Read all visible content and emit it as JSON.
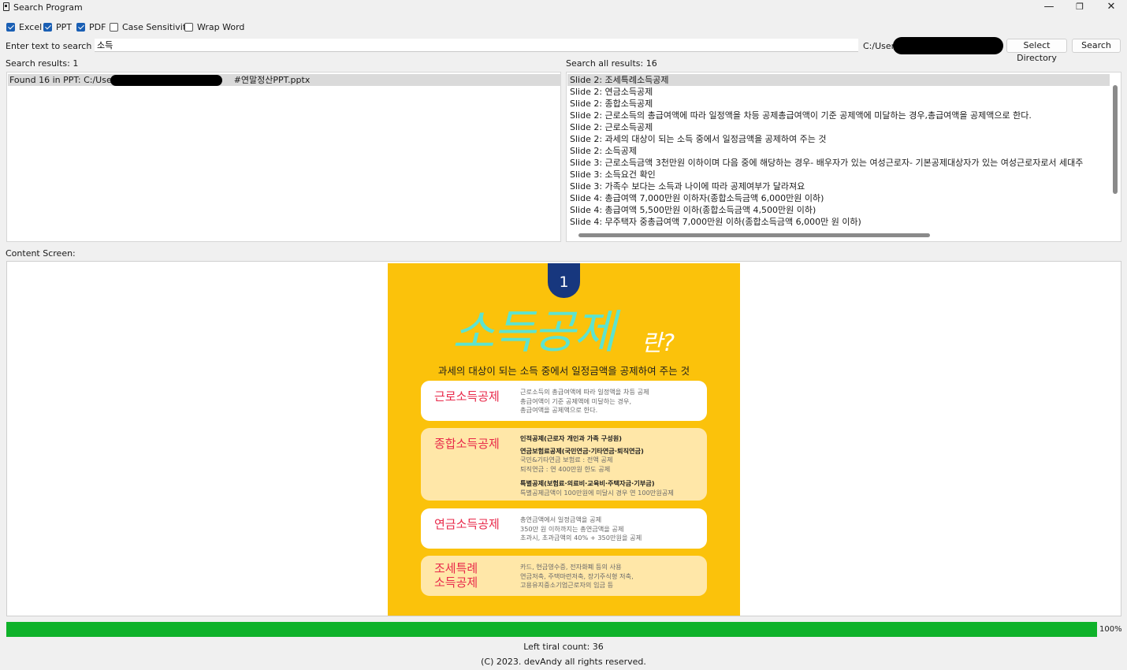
{
  "window": {
    "title": "Search Program",
    "minimize": "—",
    "maximize": "❐",
    "close": "✕"
  },
  "options": [
    {
      "label": "Excel",
      "checked": true
    },
    {
      "label": "PPT",
      "checked": true
    },
    {
      "label": "PDF",
      "checked": true
    },
    {
      "label": "Case Sensitivity",
      "checked": false
    },
    {
      "label": "Wrap Word",
      "checked": false
    }
  ],
  "search": {
    "label": "Enter text to search for:",
    "value": "소득",
    "directory": "C:/Users/",
    "select_directory_label": "Select Directory",
    "search_label": "Search"
  },
  "results": {
    "count_label": "Search results: 1",
    "item_prefix": "Found 16 in PPT: C:/Users/",
    "item_suffix": "#연말정산PPT.pptx"
  },
  "all_results": {
    "count_label": "Search all results: 16",
    "items": [
      "Slide 2: 조세특례소득공제",
      "Slide 2: 연금소득공제",
      "Slide 2: 종합소득공제",
      "Slide 2: 근로소득의 총급여액에 따라 일정액을 차등 공제총급여액이 기준 공제액에 미달하는 경우,총급여액을 공제액으로 한다.",
      "Slide 2: 근로소득공제",
      "Slide 2: 과세의 대상이 되는 소득 중에서 일정금액을 공제하여 주는 것",
      "Slide 2: 소득공제",
      "Slide 3: 근로소득금액 3천만원 이하이며 다음 중에 해당하는 경우- 배우자가 있는 여성근로자- 기본공제대상자가 있는 여성근로자로서 세대주",
      "Slide 3: 소득요건 확인",
      "Slide 3: 가족수 보다는 소득과 나이에 따라 공제여부가 달라져요",
      "Slide 4: 총급여액 7,000만원 이하자(종합소득금액 6,000만원 이하)",
      "Slide 4: 총급여액 5,500만원 이하(종합소득금액 4,500만원 이하)",
      "Slide 4: 무주택자 중총급여액 7,000만원 이하(종합소득금액 6,000만 원 이하)"
    ]
  },
  "content": {
    "label": "Content Screen:",
    "slide": {
      "number": "1",
      "title": "소득공제",
      "title_suffix": "란?",
      "subtitle": "과세의 대상이 되는 소득 중에서 일정금액을 공제하여 주는 것",
      "cards": [
        {
          "title": "근로소득공제",
          "lines": [
            "근로소득의 총급여액에 따라 일정액을 차등 공제",
            "총급여액이 기준 공제액에 미달하는 경우,",
            "총급여액을 공제액으로 한다."
          ]
        },
        {
          "title": "종합소득공제",
          "lines": [
            "인적공제(근로자 개인과 가족 구성원)",
            "연금보험료공제(국민연금·기타연금·퇴직연금)",
            "국민&기타연금 보험료 : 전액 공제",
            "퇴직연금 : 연 400만원 한도 공제",
            "특별공제(보험료·의료비·교육비·주택자금·기부금)",
            "특별공제금액이 100만원에 미달시 경우 연 100만원공제"
          ]
        },
        {
          "title": "연금소득공제",
          "lines": [
            "총연금액에서 일정금액을 공제",
            "350만 원 이하까지는 총연금액을 공제",
            "초과시, 초과금액의 40% + 350만원을 공제"
          ]
        },
        {
          "title": "조세특례\n소득공제",
          "lines": [
            "카드, 현금영수증, 전자화폐 등의 사용",
            "연금저축, 주택마련저축, 장기주식형 저축,",
            "고용유지중소기업근로자의 임금 등"
          ]
        }
      ]
    }
  },
  "progress": {
    "value": 100,
    "label": "100%",
    "color": "#0fb22a"
  },
  "footer": {
    "trial": "Left tiral count: 36",
    "copyright": "(C) 2023. devAndy all rights reserved."
  }
}
